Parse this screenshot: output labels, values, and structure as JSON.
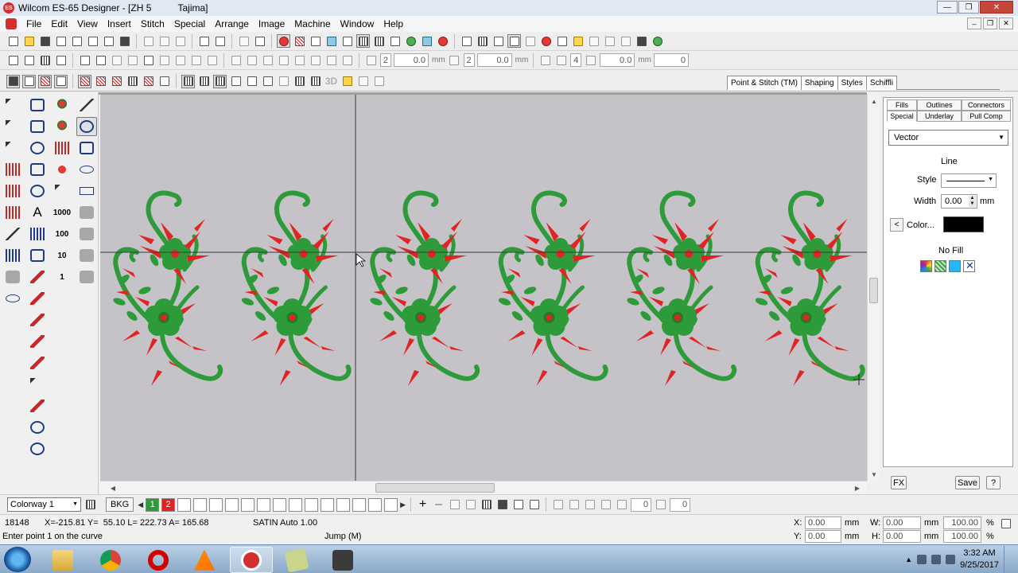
{
  "window": {
    "title": "Wilcom ES-65 Designer - [ZH 5          Tajima]",
    "min": "—",
    "max": "❐",
    "close": "✕"
  },
  "menu": {
    "items": [
      "File",
      "Edit",
      "View",
      "Insert",
      "Stitch",
      "Special",
      "Arrange",
      "Image",
      "Machine",
      "Window",
      "Help"
    ]
  },
  "toolbar2": {
    "spin1": "2",
    "spin2": "0.0",
    "unit1": "mm",
    "spin3": "2",
    "spin4": "0.0",
    "unit2": "mm",
    "spin5": "4",
    "spin6": "0.0",
    "unit3": "mm",
    "spin7": "0"
  },
  "toolbar3": {
    "label_3d": "3D"
  },
  "object_tabs": [
    "Point & Stitch (TM)",
    "Shaping",
    "Styles",
    "Schiffli"
  ],
  "toolbox": {
    "count_1000": "1000",
    "count_100": "100",
    "count_10": "10",
    "count_1": "1"
  },
  "properties_panel": {
    "tabs_row1": [
      "Fills",
      "Outlines",
      "Connectors"
    ],
    "tabs_row2": [
      "Special",
      "Underlay",
      "Pull Comp"
    ],
    "mode": "Vector",
    "section_line": "Line",
    "style_label": "Style",
    "width_label": "Width",
    "width_value": "0.00",
    "width_unit": "mm",
    "color_label": "Color...",
    "color_btn": "<",
    "color_value": "#000000",
    "no_fill": "No Fill",
    "fx_button": "FX",
    "save_button": "Save",
    "help_button": "?"
  },
  "colorbar": {
    "colorway": "Colorway 1",
    "bkg_button": "BKG",
    "colors": [
      {
        "label": "1",
        "hex": "#2e9b3a"
      },
      {
        "label": "2",
        "hex": "#e02424"
      }
    ],
    "spin1": "0",
    "spin2": "0"
  },
  "status": {
    "stitch_count": "18148",
    "coords": "X=-215.81 Y=  55.10 L= 222.73 A= 165.68",
    "stitch_type": "SATIN Auto  1.00",
    "prompt": "Enter point  1 on the curve",
    "jump": "Jump (M)",
    "x_label": "X:",
    "x_value": "0.00",
    "x_unit": "mm",
    "y_label": "Y:",
    "y_value": "0.00",
    "y_unit": "mm",
    "w_label": "W:",
    "w_value": "0.00",
    "w_unit": "mm",
    "h_label": "H:",
    "h_value": "0.00",
    "h_unit": "mm",
    "wp_value": "100.00",
    "wp_unit": "%",
    "hp_value": "100.00",
    "hp_unit": "%"
  },
  "taskbar": {
    "time": "3:32 AM",
    "date": "9/25/2017"
  },
  "design": {
    "motif_count": 6,
    "colors": {
      "green": "#2e9b3a",
      "green_dark": "#1f7a2a",
      "red": "#e02424",
      "canvas": "#c6c3c8"
    }
  }
}
